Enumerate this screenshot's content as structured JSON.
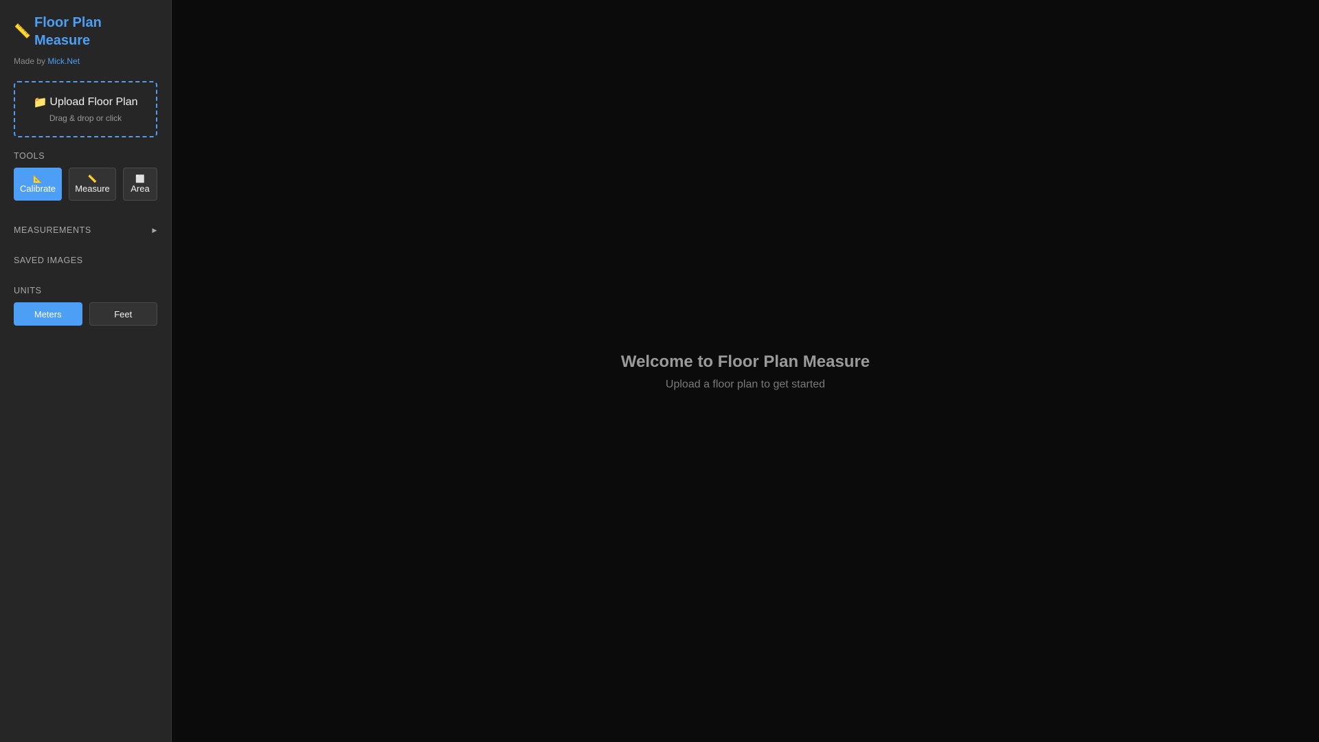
{
  "sidebar": {
    "brand": {
      "icon": "📏",
      "title": "Floor Plan Measure"
    },
    "made_by": {
      "prefix": "Made by",
      "link": "Mick.Net"
    },
    "upload": {
      "icon": "📁",
      "title": "Upload Floor Plan",
      "subtitle": "Drag & drop or click"
    },
    "tools": {
      "label": "TOOLS",
      "items": [
        {
          "icon": "📐",
          "label": "Calibrate",
          "active": true
        },
        {
          "icon": "📏",
          "label": "Measure",
          "active": false
        },
        {
          "icon": "⬜",
          "label": "Area",
          "active": false
        }
      ]
    },
    "measurements": {
      "label": "MEASUREMENTS",
      "arrow": "▶"
    },
    "saved_images": {
      "label": "SAVED IMAGES"
    },
    "units": {
      "label": "UNITS",
      "items": [
        {
          "label": "Meters",
          "active": true
        },
        {
          "label": "Feet",
          "active": false
        }
      ]
    }
  },
  "main": {
    "title": "Welcome to Floor Plan Measure",
    "subtitle": "Upload a floor plan to get started"
  },
  "colors": {
    "accent": "#4d9ff5",
    "sidebar_bg": "#262626",
    "main_bg": "#0b0b0b"
  }
}
